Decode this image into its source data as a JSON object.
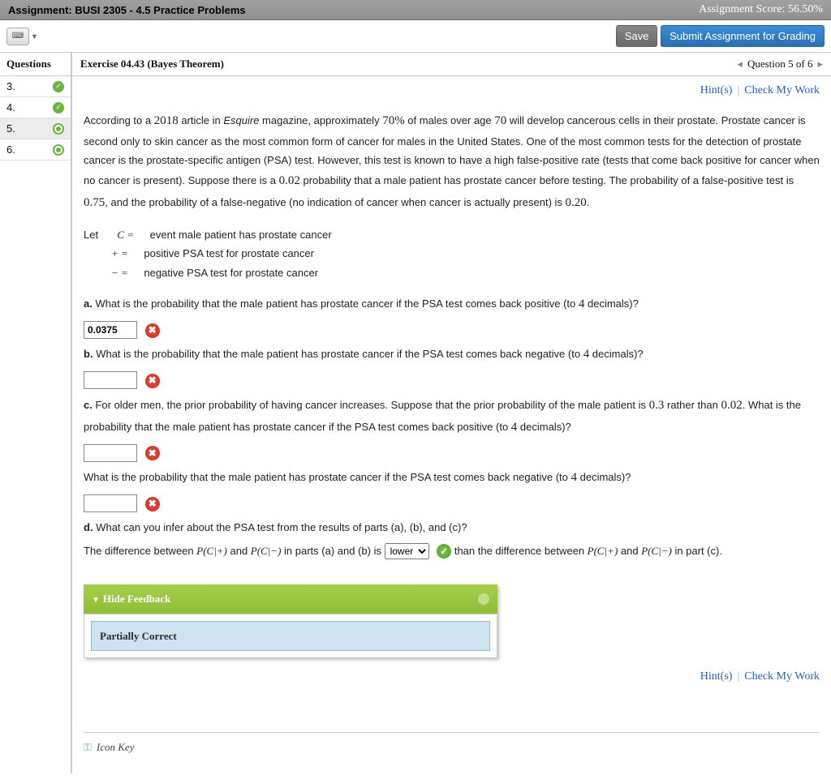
{
  "header": {
    "assignment_label": "Assignment: BUSI 2305 - 4.5 Practice Problems",
    "score_label": "Assignment Score: 56.50%"
  },
  "toolbar": {
    "save_label": "Save",
    "submit_label": "Submit Assignment for Grading"
  },
  "qpanel": {
    "header": "Questions",
    "items": [
      {
        "num": "3.",
        "status": "ok-full"
      },
      {
        "num": "4.",
        "status": "ok-full"
      },
      {
        "num": "5.",
        "status": "ok-ring",
        "selected": true
      },
      {
        "num": "6.",
        "status": "ok-ring"
      }
    ]
  },
  "content_header": {
    "exercise_title": "Exercise 04.43 (Bayes Theorem)",
    "position_label": "Question 5 of 6"
  },
  "links": {
    "hints": "Hint(s)",
    "check": "Check My Work"
  },
  "problem": {
    "intro_1": "According to a ",
    "year": "2018",
    "intro_2": " article in ",
    "esquire": "Esquire",
    "intro_3": " magazine, approximately ",
    "pct": "70%",
    "intro_4": " of males over age ",
    "age": "70",
    "intro_5": " will develop cancerous cells in their prostate. Prostate cancer is second only to skin cancer as the most common form of cancer for males in the United States. One of the most common tests for the detection of prostate cancer is the prostate-specific antigen (PSA) test. However, this test is known to have a high false-positive rate (tests that come back positive for cancer when no cancer is present). Suppose there is a ",
    "p_prior": "0.02",
    "intro_6": " probability that a male patient has prostate cancer before testing. The probability of a false-positive test is ",
    "p_fp": "0.75",
    "intro_7": ", and the probability of a false-negative (no indication of cancer when cancer is actually present) is ",
    "p_fn": "0.20",
    "intro_8": ".",
    "let_line": "Let",
    "let_c": "C =",
    "let_c_desc": "event male patient has prostate cancer",
    "let_plus": "+ =",
    "let_plus_desc": "positive PSA test for prostate cancer",
    "let_minus": "− =",
    "let_minus_desc": "negative PSA test for prostate cancer",
    "a_label": "a.",
    "a_text": "What is the probability that the male patient has prostate cancer if the PSA test comes back positive (to ",
    "dec4": "4",
    "a_text2": " decimals)?",
    "a_value": "0.0375",
    "b_label": "b.",
    "b_text": "What is the probability that the male patient has prostate cancer if the PSA test comes back negative (to ",
    "c_label": "c.",
    "c_text": "For older men, the prior probability of having cancer increases. Suppose that the prior probability of the male patient is ",
    "c_prior": "0.3",
    "c_text2": " rather than ",
    "c_text3": ". What is the probability that the male patient has prostate cancer if the PSA test comes back positive (to ",
    "c_text4": "What is the probability that the male patient has prostate cancer if the PSA test comes back negative (to ",
    "d_label": "d.",
    "d_text": "What can you infer about the PSA test from the results of parts (a), (b), and (c)?",
    "d_sentence1": "The difference between ",
    "d_f1": "P(C|+)",
    "d_and": " and ",
    "d_f2": "P(C|−)",
    "d_sentence2": " in parts (a) and (b) is ",
    "d_select_value": "lower",
    "d_sentence3": " than the difference between ",
    "d_sentence4": " in part (c)."
  },
  "feedback": {
    "header": "Hide Feedback",
    "status": "Partially Correct"
  },
  "iconkey": {
    "label": "Icon Key"
  }
}
